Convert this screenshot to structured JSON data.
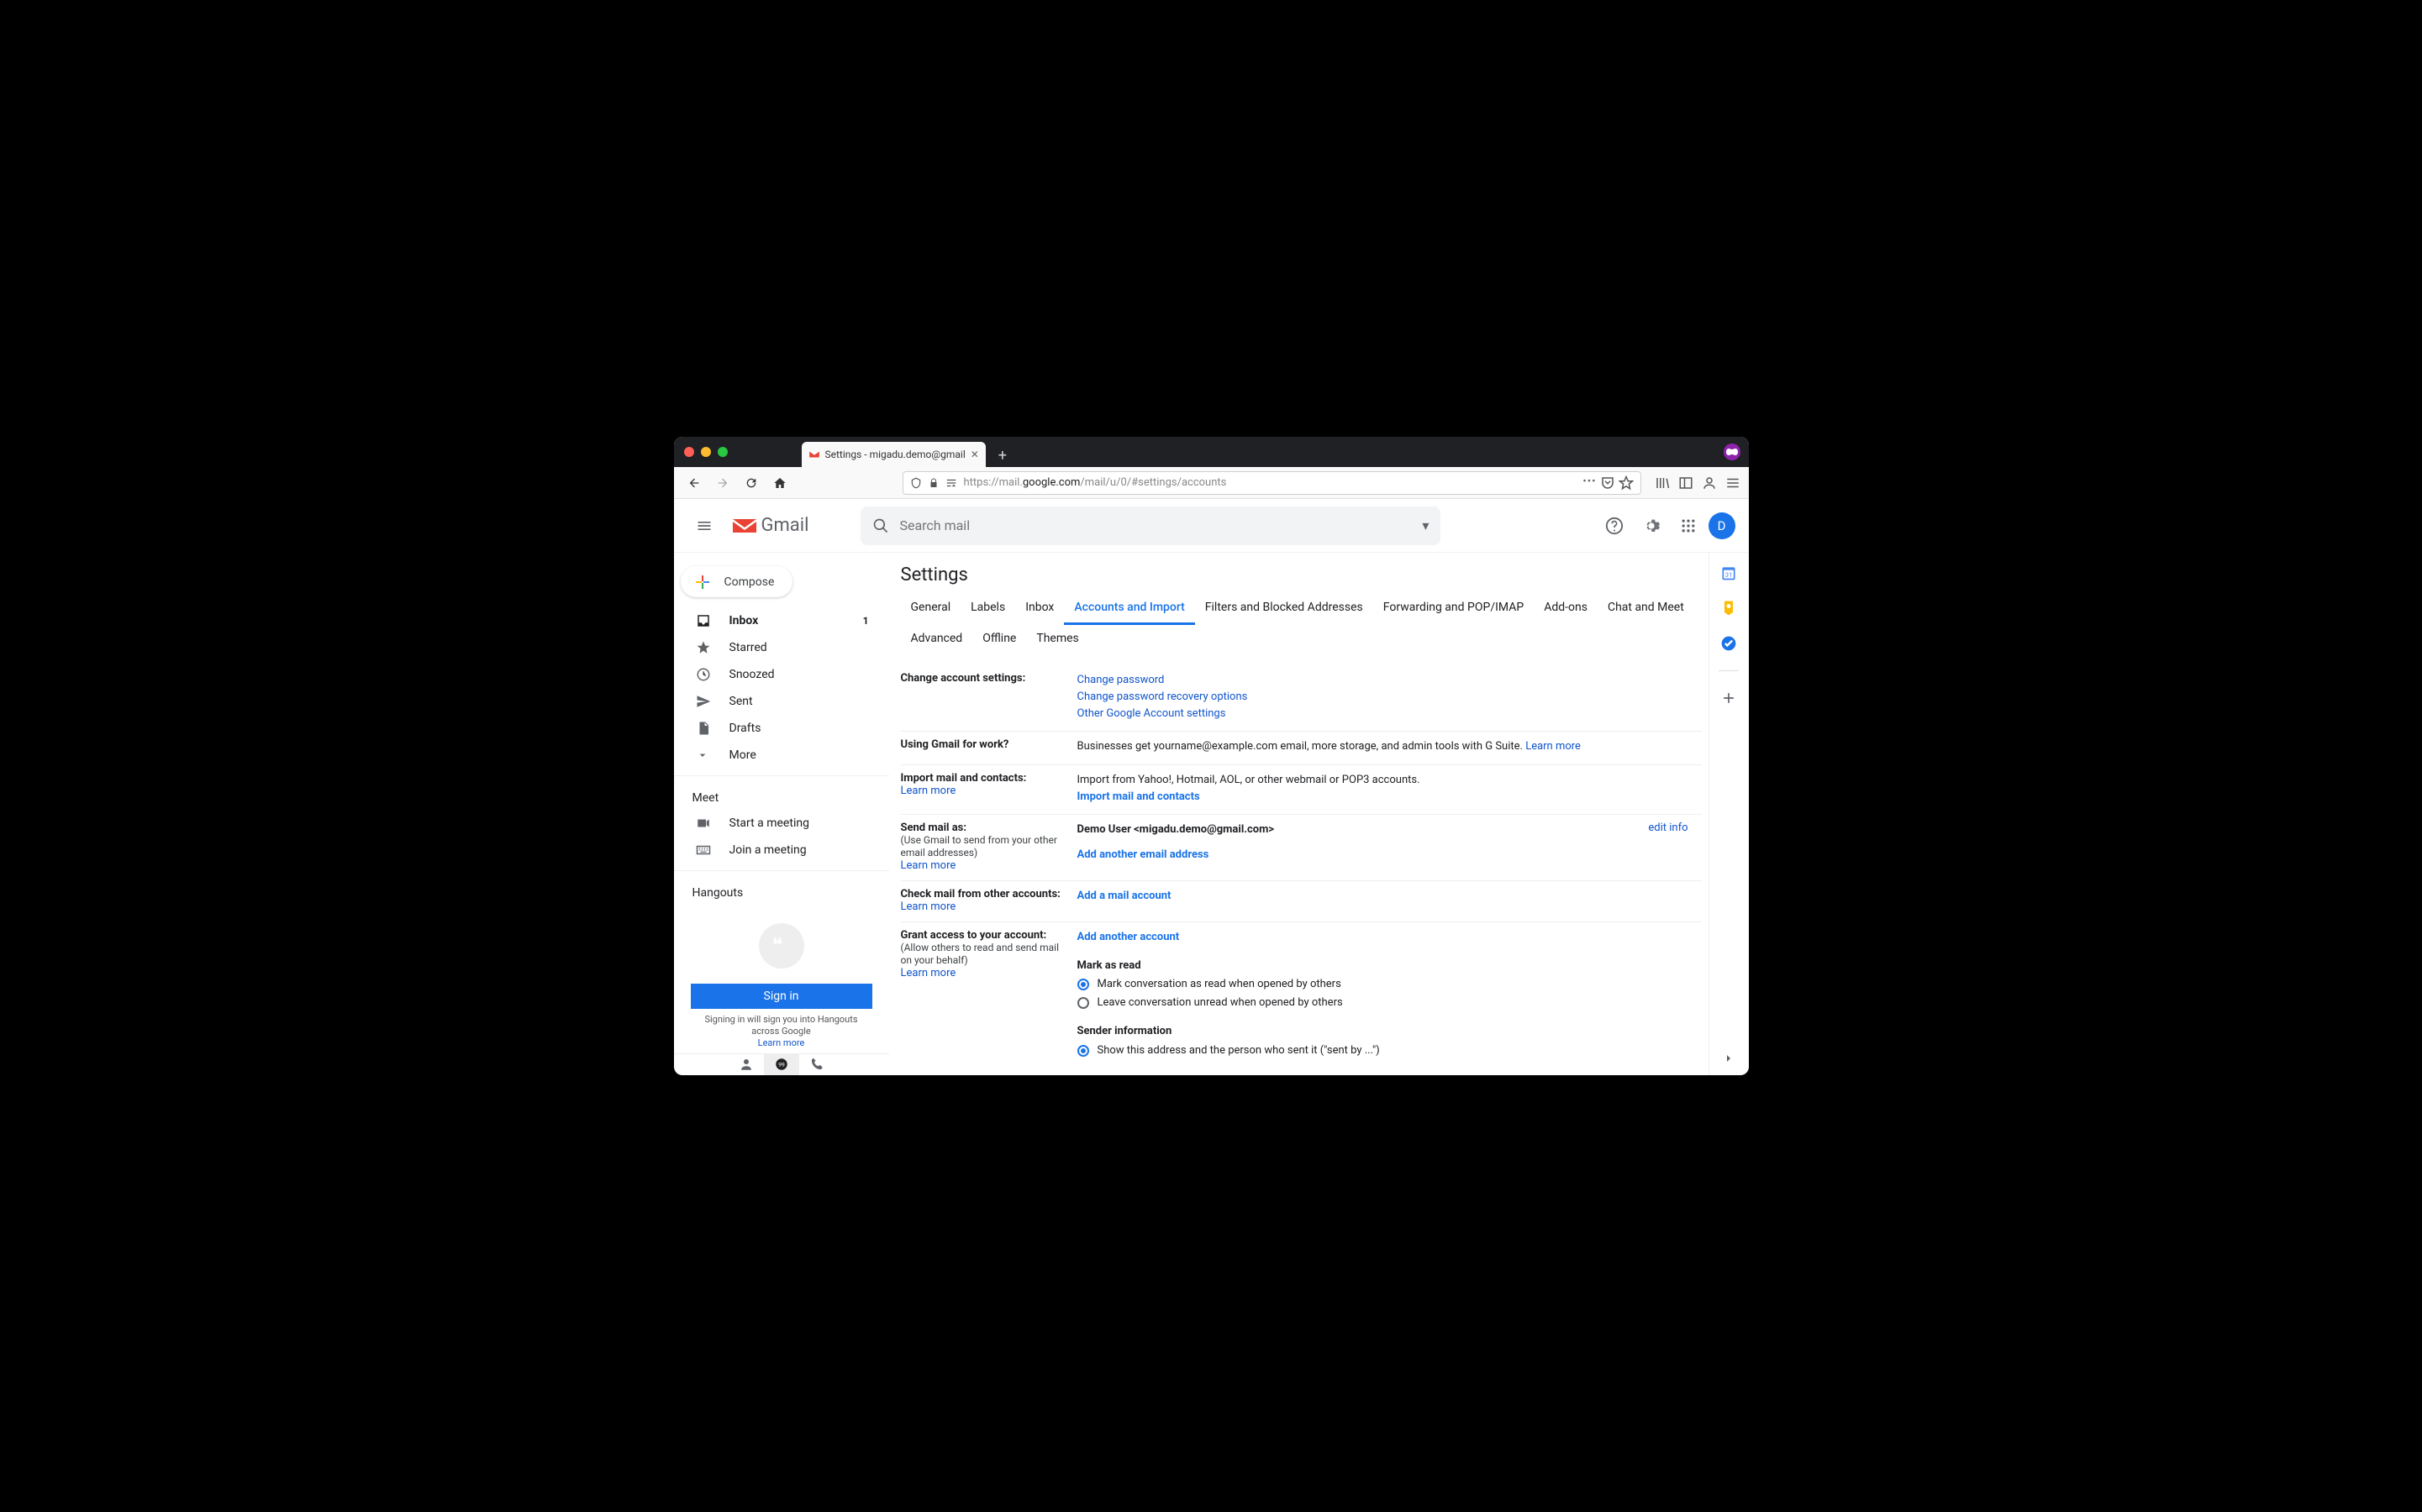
{
  "browser": {
    "tab_title": "Settings - migadu.demo@gmail",
    "url_prefix": "https://mail.",
    "url_host": "google.com",
    "url_path": "/mail/u/0/#settings/accounts"
  },
  "header": {
    "product": "Gmail",
    "search_placeholder": "Search mail",
    "avatar_letter": "D"
  },
  "sidebar": {
    "compose": "Compose",
    "items": [
      {
        "label": "Inbox",
        "count": "1"
      },
      {
        "label": "Starred"
      },
      {
        "label": "Snoozed"
      },
      {
        "label": "Sent"
      },
      {
        "label": "Drafts"
      },
      {
        "label": "More"
      }
    ],
    "meet_label": "Meet",
    "meet_items": [
      "Start a meeting",
      "Join a meeting"
    ],
    "hangouts_label": "Hangouts",
    "signin": "Sign in",
    "signin_note1": "Signing in will sign you into Hangouts",
    "signin_note2": "across Google",
    "signin_learn": "Learn more"
  },
  "settings": {
    "title": "Settings",
    "tabs": [
      "General",
      "Labels",
      "Inbox",
      "Accounts and Import",
      "Filters and Blocked Addresses",
      "Forwarding and POP/IMAP",
      "Add-ons",
      "Chat and Meet",
      "Advanced",
      "Offline",
      "Themes"
    ],
    "active_tab": "Accounts and Import",
    "change_account": {
      "label": "Change account settings:",
      "links": [
        "Change password",
        "Change password recovery options",
        "Other Google Account settings"
      ]
    },
    "work": {
      "label": "Using Gmail for work?",
      "text": "Businesses get yourname@example.com email, more storage, and admin tools with G Suite. ",
      "link": "Learn more"
    },
    "import": {
      "label": "Import mail and contacts:",
      "learn": "Learn more",
      "text": "Import from Yahoo!, Hotmail, AOL, or other webmail or POP3 accounts.",
      "action": "Import mail and contacts"
    },
    "send_as": {
      "label": "Send mail as:",
      "sub": "(Use Gmail to send from your other email addresses)",
      "learn": "Learn more",
      "identity": "Demo User <migadu.demo@gmail.com>",
      "add": "Add another email address",
      "edit": "edit info"
    },
    "check_mail": {
      "label": "Check mail from other accounts:",
      "learn": "Learn more",
      "add": "Add a mail account"
    },
    "grant": {
      "label": "Grant access to your account:",
      "sub": "(Allow others to read and send mail on your behalf)",
      "learn": "Learn more",
      "add": "Add another account",
      "mark_label": "Mark as read",
      "mark_opt1": "Mark conversation as read when opened by others",
      "mark_opt2": "Leave conversation unread when opened by others",
      "sender_label": "Sender information",
      "sender_opt1": "Show this address and the person who sent it (\"sent by ...\")"
    }
  }
}
